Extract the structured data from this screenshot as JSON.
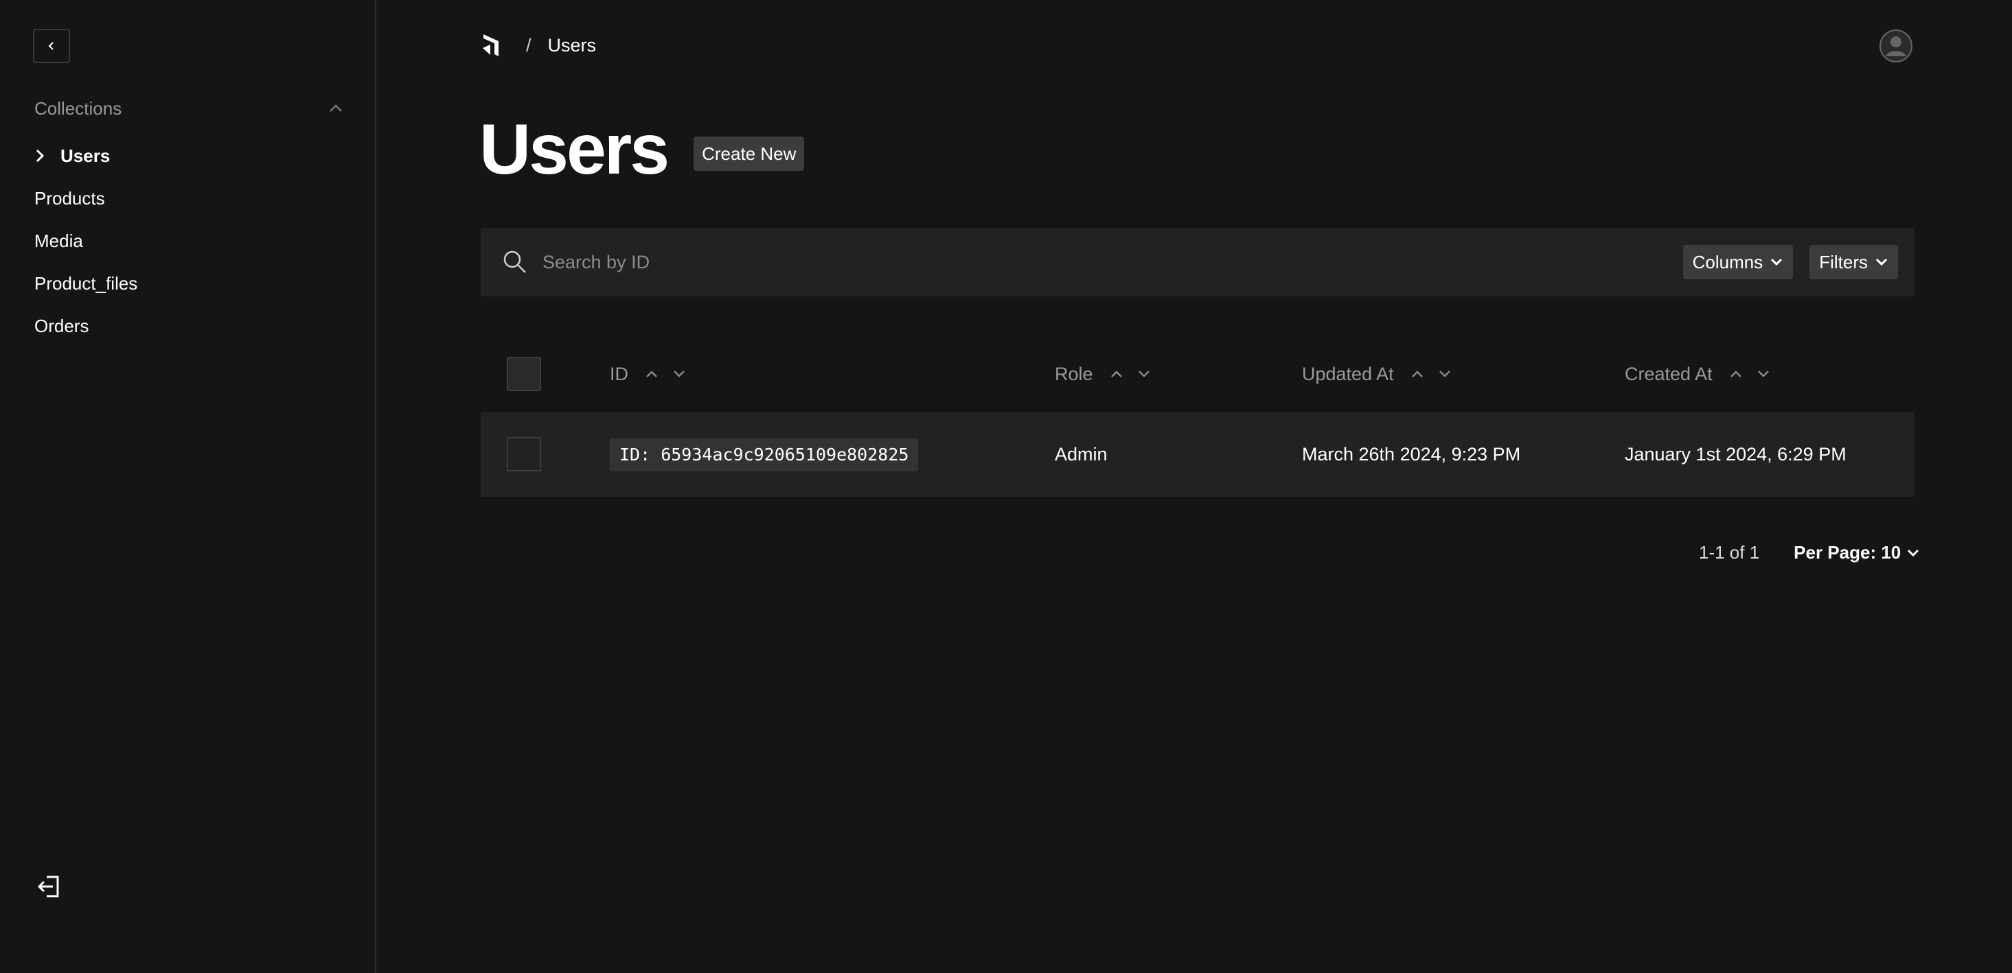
{
  "sidebar": {
    "collections_label": "Collections",
    "items": [
      {
        "label": "Users",
        "active": true
      },
      {
        "label": "Products"
      },
      {
        "label": "Media"
      },
      {
        "label": "Product_files"
      },
      {
        "label": "Orders"
      }
    ]
  },
  "breadcrumb": {
    "separator": "/",
    "current": "Users"
  },
  "header": {
    "title": "Users",
    "create_label": "Create New"
  },
  "search": {
    "placeholder": "Search by ID",
    "columns_label": "Columns",
    "filters_label": "Filters"
  },
  "table": {
    "columns": [
      "ID",
      "Role",
      "Updated At",
      "Created At"
    ],
    "rows": [
      {
        "id": "ID: 65934ac9c92065109e802825",
        "role": "Admin",
        "updated_at": "March 26th 2024, 9:23 PM",
        "created_at": "January 1st 2024, 6:29 PM"
      }
    ]
  },
  "pagination": {
    "info": "1-1 of 1",
    "per_page": "Per Page: 10"
  },
  "colors": {
    "background": "#151515",
    "panel": "#222222",
    "button": "#3c3c3c",
    "muted_text": "#9a9a9a"
  }
}
